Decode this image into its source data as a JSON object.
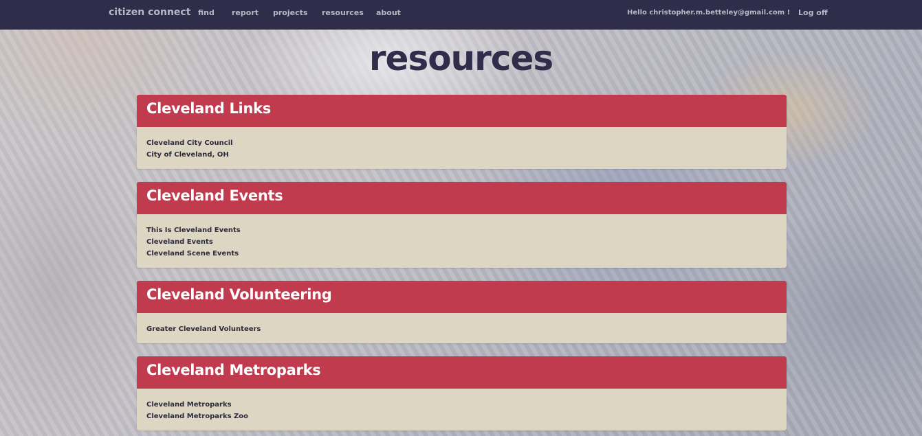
{
  "nav": {
    "brand": "citizen connect",
    "links": [
      "find",
      "report",
      "projects",
      "resources",
      "about"
    ],
    "greeting": "Hello christopher.m.betteley@gmail.com !",
    "logoff": "Log off"
  },
  "page": {
    "title": "resources"
  },
  "sections": [
    {
      "title": "Cleveland Links",
      "links": [
        "Cleveland City Council",
        "City of Cleveland, OH"
      ]
    },
    {
      "title": "Cleveland Events",
      "links": [
        "This Is Cleveland Events",
        "Cleveland Events",
        "Cleveland Scene Events"
      ]
    },
    {
      "title": "Cleveland Volunteering",
      "links": [
        "Greater Cleveland Volunteers"
      ]
    },
    {
      "title": "Cleveland Metroparks",
      "links": [
        "Cleveland Metroparks",
        "Cleveland Metroparks Zoo"
      ]
    }
  ],
  "colors": {
    "navbar": "#2f2d4a",
    "panel_header": "#c13b4f",
    "panel_body": "#ddd6c3",
    "title_text": "#2f2d4a"
  }
}
